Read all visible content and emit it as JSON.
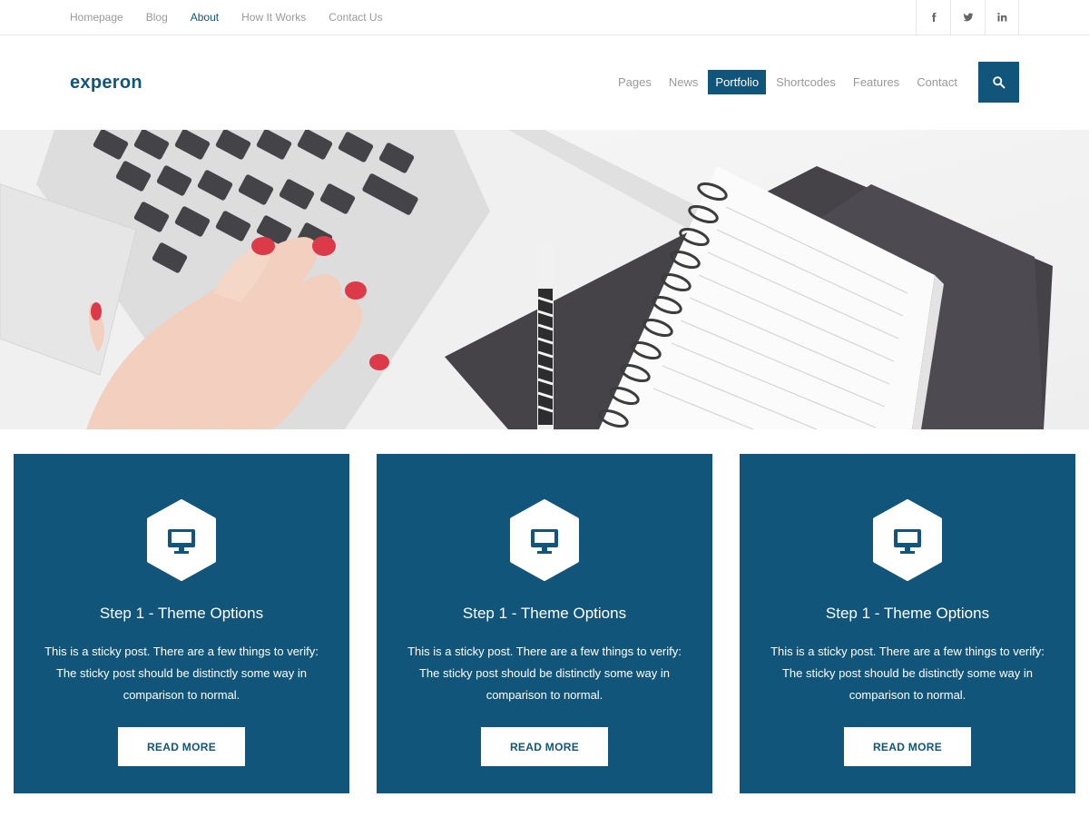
{
  "topbar": {
    "links": [
      {
        "label": "Homepage"
      },
      {
        "label": "Blog"
      },
      {
        "label": "About"
      },
      {
        "label": "How It Works"
      },
      {
        "label": "Contact Us"
      }
    ],
    "active_link": "About",
    "social": [
      "facebook-icon",
      "twitter-icon",
      "linkedin-icon"
    ]
  },
  "header": {
    "logo": "experon",
    "nav": [
      {
        "label": "Pages"
      },
      {
        "label": "News"
      },
      {
        "label": "Portfolio"
      },
      {
        "label": "Shortcodes"
      },
      {
        "label": "Features"
      },
      {
        "label": "Contact"
      }
    ],
    "active_nav": "Portfolio",
    "search_icon": "search-icon"
  },
  "hero": {
    "image": "laptop-hand-notebook-photo"
  },
  "cards": [
    {
      "icon": "monitor-icon",
      "title": "Step 1 - Theme Options",
      "text": "This is a sticky post. There are a few things to verify: The sticky post should be distinctly some way in comparison to normal.",
      "button": "READ MORE"
    },
    {
      "icon": "monitor-icon",
      "title": "Step 1 - Theme Options",
      "text": "This is a sticky post. There are a few things to verify: The sticky post should be distinctly some way in comparison to normal.",
      "button": "READ MORE"
    },
    {
      "icon": "monitor-icon",
      "title": "Step 1 - Theme Options",
      "text": "This is a sticky post. There are a few things to verify: The sticky post should be distinctly some way in comparison to normal.",
      "button": "READ MORE"
    }
  ],
  "colors": {
    "brand": "#12557a",
    "muted_text": "#9a9a9a",
    "border": "#e6e6e6"
  }
}
